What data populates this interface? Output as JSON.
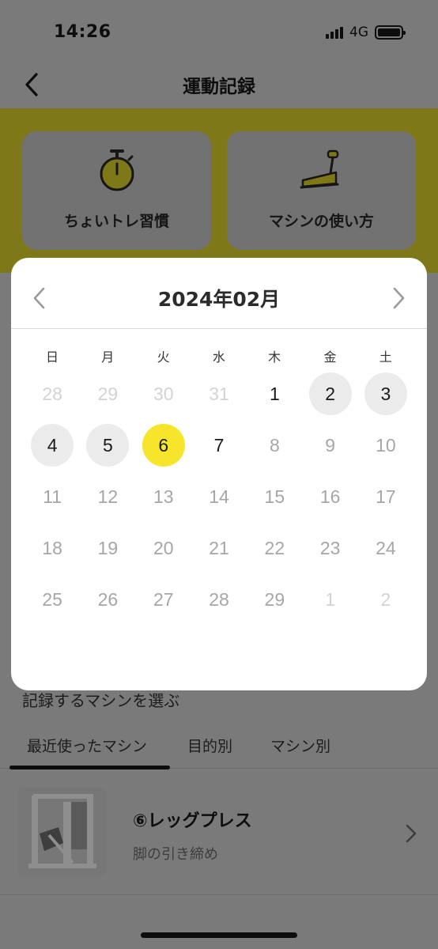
{
  "status_bar": {
    "time": "14:26",
    "network": "4G"
  },
  "header": {
    "title": "運動記録"
  },
  "menu_cards": [
    {
      "label": "ちょいトレ習慣",
      "icon": "stopwatch-icon"
    },
    {
      "label": "マシンの使い方",
      "icon": "treadmill-icon"
    }
  ],
  "section": {
    "label": "記録するマシンを選ぶ"
  },
  "tabs": [
    {
      "label": "最近使ったマシン",
      "selected": true
    },
    {
      "label": "目的別",
      "selected": false
    },
    {
      "label": "マシン別",
      "selected": false
    }
  ],
  "machine": {
    "name": "⑥レッグプレス",
    "description": "脚の引き締め"
  },
  "calendar": {
    "title": "2024年02月",
    "weekdays": [
      "日",
      "月",
      "火",
      "水",
      "木",
      "金",
      "土"
    ],
    "weeks": [
      [
        {
          "d": "28",
          "s": "muted"
        },
        {
          "d": "29",
          "s": "muted"
        },
        {
          "d": "30",
          "s": "muted"
        },
        {
          "d": "31",
          "s": "muted"
        },
        {
          "d": "1",
          "s": "normal"
        },
        {
          "d": "2",
          "s": "recorded"
        },
        {
          "d": "3",
          "s": "recorded"
        }
      ],
      [
        {
          "d": "4",
          "s": "recorded"
        },
        {
          "d": "5",
          "s": "recorded"
        },
        {
          "d": "6",
          "s": "today"
        },
        {
          "d": "7",
          "s": "normal"
        },
        {
          "d": "8",
          "s": "future"
        },
        {
          "d": "9",
          "s": "future"
        },
        {
          "d": "10",
          "s": "future"
        }
      ],
      [
        {
          "d": "11",
          "s": "future"
        },
        {
          "d": "12",
          "s": "future"
        },
        {
          "d": "13",
          "s": "future"
        },
        {
          "d": "14",
          "s": "future"
        },
        {
          "d": "15",
          "s": "future"
        },
        {
          "d": "16",
          "s": "future"
        },
        {
          "d": "17",
          "s": "future"
        }
      ],
      [
        {
          "d": "18",
          "s": "future"
        },
        {
          "d": "19",
          "s": "future"
        },
        {
          "d": "20",
          "s": "future"
        },
        {
          "d": "21",
          "s": "future"
        },
        {
          "d": "22",
          "s": "future"
        },
        {
          "d": "23",
          "s": "future"
        },
        {
          "d": "24",
          "s": "future"
        }
      ],
      [
        {
          "d": "25",
          "s": "future"
        },
        {
          "d": "26",
          "s": "future"
        },
        {
          "d": "27",
          "s": "future"
        },
        {
          "d": "28",
          "s": "future"
        },
        {
          "d": "29",
          "s": "future"
        },
        {
          "d": "1",
          "s": "muted"
        },
        {
          "d": "2",
          "s": "muted"
        }
      ]
    ]
  },
  "colors": {
    "accent": "#f7e52b",
    "recorded": "#ebebeb",
    "overlay": "#7a7a7a"
  }
}
